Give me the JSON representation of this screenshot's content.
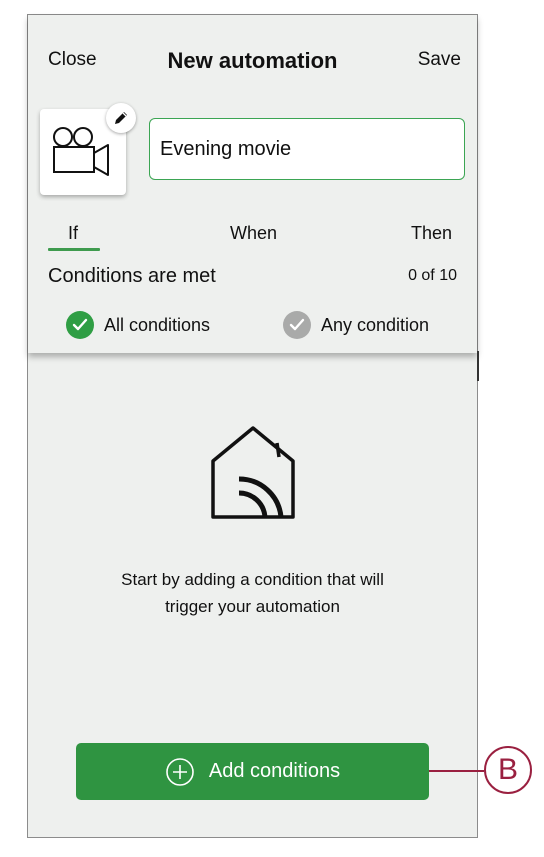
{
  "header": {
    "close_label": "Close",
    "title": "New automation",
    "save_label": "Save"
  },
  "automation": {
    "icon": "movie-camera-icon",
    "edit_icon": "pencil-icon",
    "name_value": "Evening movie"
  },
  "tabs": [
    {
      "label": "If",
      "active": true
    },
    {
      "label": "When",
      "active": false
    },
    {
      "label": "Then",
      "active": false
    }
  ],
  "conditions": {
    "title": "Conditions are met",
    "count": "0 of 10",
    "options": [
      {
        "label": "All conditions",
        "selected": true,
        "icon": "check-circle-icon"
      },
      {
        "label": "Any condition",
        "selected": false,
        "icon": "check-circle-icon"
      }
    ]
  },
  "empty_state": {
    "icon": "smart-home-icon",
    "line1": "Start by adding a condition that will",
    "line2": "trigger your automation"
  },
  "add_button": {
    "label": "Add conditions",
    "icon": "plus-circle-icon"
  },
  "callout": {
    "label": "B"
  },
  "colors": {
    "accent": "#2f9441",
    "field_border": "#3ba553",
    "background": "#eef0ee",
    "callout": "#9a2040",
    "inactive": "#a9aaa9"
  }
}
